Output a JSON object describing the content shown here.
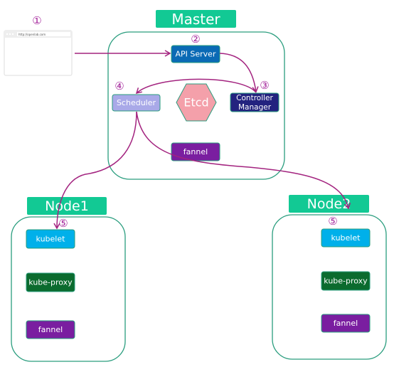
{
  "master": {
    "title": "Master",
    "api_server": "API Server",
    "controller_manager_line1": "Controller",
    "controller_manager_line2": "Manager",
    "scheduler": "Scheduler",
    "etcd": "Etcd",
    "fannel": "fannel"
  },
  "node1": {
    "title": "Node1",
    "kubelet": "kubelet",
    "kube_proxy": "kube-proxy",
    "fannel": "fannel"
  },
  "node2": {
    "title": "Node2",
    "kubelet": "kubelet",
    "kube_proxy": "kube-proxy",
    "fannel": "fannel"
  },
  "browser": {
    "url": "http://openlab.com"
  },
  "steps": [
    "①",
    "②",
    "③",
    "④",
    "⑤",
    "⑤"
  ],
  "colors": {
    "label_green": "#12c994",
    "container_stroke": "#2a9d7e",
    "api_server": "#0a6ab5",
    "controller": "#23237f",
    "scheduler": "#a9a9e8",
    "etcd": "#f4a0aa",
    "fannel": "#7a1ea0",
    "kubelet": "#00b0ea",
    "kube_proxy": "#0b6b2e",
    "arrow": "#a3237f"
  }
}
